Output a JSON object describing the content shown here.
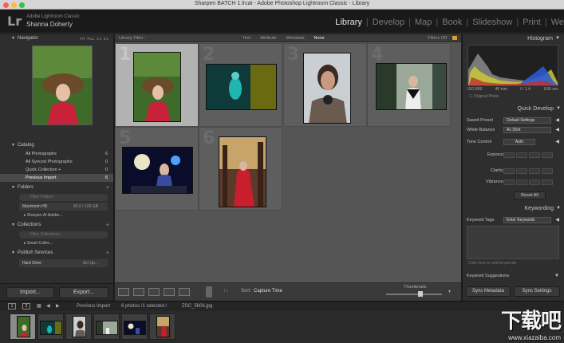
{
  "window": {
    "title": "Sharpen BATCH 1.lrcat - Adobe Photoshop Lightroom Classic - Library"
  },
  "identity": {
    "logo": "Lr",
    "product": "Adobe Lightroom Classic",
    "user": "Shanna Doherty"
  },
  "modules": [
    "Library",
    "Develop",
    "Map",
    "Book",
    "Slideshow",
    "Print",
    "We"
  ],
  "left": {
    "navigator": {
      "title": "Navigator",
      "zoom": [
        "FIT",
        "FILL",
        "1:1",
        "3:1"
      ]
    },
    "catalog": {
      "title": "Catalog",
      "items": [
        {
          "label": "All Photographs",
          "count": "6"
        },
        {
          "label": "All Synced Photographs",
          "count": "0"
        },
        {
          "label": "Quick Collection +",
          "count": "0"
        },
        {
          "label": "Previous Import",
          "count": "6"
        }
      ]
    },
    "folders": {
      "title": "Folders",
      "filter_placeholder": "Filter Folders",
      "volume": "Macintosh HD",
      "volume_size": "82.6 / 100 GB",
      "folder": "Sharpen AI Adobe..."
    },
    "collections": {
      "title": "Collections",
      "filter_placeholder": "Filter Collections",
      "item": "Smart Collec..."
    },
    "publish": {
      "title": "Publish Services",
      "item": "Hard Drive",
      "action": "Set Up..."
    },
    "import_label": "Import...",
    "export_label": "Export..."
  },
  "center": {
    "filter_bar": {
      "title": "Library Filter :",
      "options": [
        "Text",
        "Attribute",
        "Metadata",
        "None"
      ],
      "active": "None",
      "right": "Filters Off"
    },
    "toolbar": {
      "sort_label": "Sort:",
      "sort_value": "Capture Time",
      "thumb_label": "Thumbnails"
    }
  },
  "grid": [
    {
      "num": "1",
      "selected": true
    },
    {
      "num": "2",
      "selected": false
    },
    {
      "num": "3",
      "selected": false
    },
    {
      "num": "4",
      "selected": false
    },
    {
      "num": "5",
      "selected": false
    },
    {
      "num": "6",
      "selected": false
    }
  ],
  "right": {
    "histogram": {
      "title": "Histogram",
      "iso": "ISO 800",
      "focal": "40 mm",
      "aperture": "f / 1.4",
      "shutter": "1/60 sec",
      "original": "Original Photo"
    },
    "quick_develop": {
      "title": "Quick Develop",
      "saved_preset_label": "Saved Preset",
      "saved_preset_value": "Default Settings",
      "white_balance_label": "White Balance",
      "white_balance_value": "As Shot",
      "tone_control_label": "Tone Control",
      "tone_control_value": "Auto",
      "exposure_label": "Exposure",
      "clarity_label": "Clarity",
      "vibrance_label": "Vibrance",
      "reset_label": "Reset All"
    },
    "keywording": {
      "title": "Keywording",
      "tags_label": "Keyword Tags",
      "tags_value": "Enter Keywords",
      "click_hint": "Click here to add keywords",
      "suggestions": "Keyword Suggestions"
    },
    "sync_metadata": "Sync Metadata",
    "sync_settings": "Sync Settings"
  },
  "filmstrip": {
    "screen1": "1",
    "screen2": "2",
    "source_label": "Previous Import",
    "status": "6 photos /1 selected /",
    "filename": "ZSC_5606.jpg"
  },
  "watermark": {
    "text": "下载吧",
    "url": "www.xiazaiba.com"
  }
}
